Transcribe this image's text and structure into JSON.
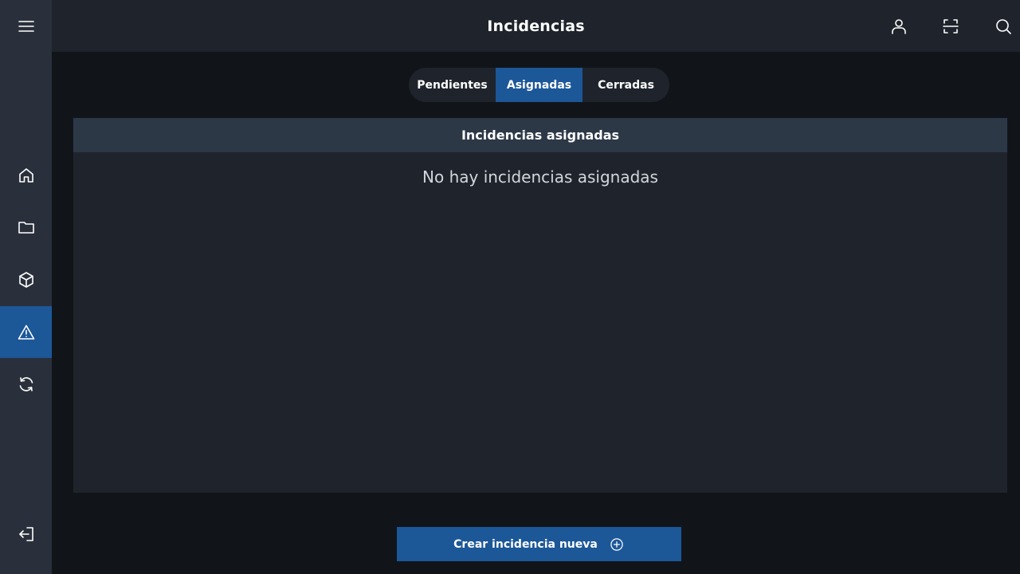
{
  "header": {
    "title": "Incidencias",
    "icons": [
      "user-icon",
      "scan-icon",
      "search-icon"
    ]
  },
  "sidebar": {
    "items": [
      {
        "icon": "menu-icon"
      },
      {
        "icon": "home-icon"
      },
      {
        "icon": "folder-icon"
      },
      {
        "icon": "box-icon"
      },
      {
        "icon": "warning-icon",
        "active": true
      },
      {
        "icon": "sync-icon"
      },
      {
        "icon": "logout-icon"
      }
    ],
    "active_color": "#1c5798"
  },
  "tabs": [
    {
      "label": "Pendientes"
    },
    {
      "label": "Asignadas",
      "active": true
    },
    {
      "label": "Cerradas"
    }
  ],
  "panel": {
    "header": "Incidencias asignadas",
    "empty_message": "No hay incidencias asignadas"
  },
  "create_button": {
    "label": "Crear incidencia nueva",
    "icon": "plus-circle-icon"
  },
  "colors": {
    "accent": "#1c5798",
    "background": "#11151a",
    "surface": "#1f242c",
    "sidebar": "#2a303b"
  }
}
